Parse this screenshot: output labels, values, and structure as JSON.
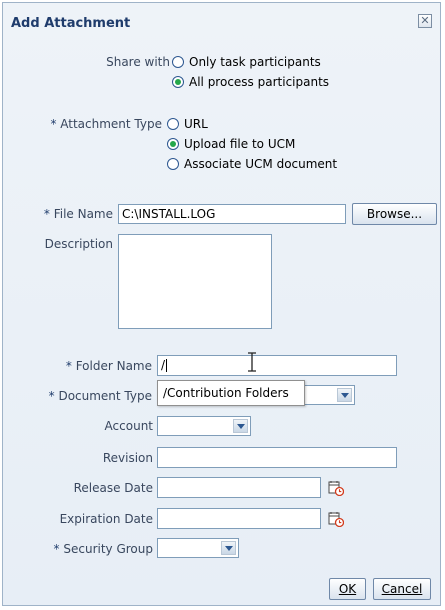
{
  "dialog": {
    "title": "Add Attachment",
    "close_glyph": "✕"
  },
  "share_with": {
    "label": "Share with",
    "options": [
      "Only task participants",
      "All process participants"
    ],
    "selected_index": 1
  },
  "attachment_type": {
    "required": "*",
    "label": "Attachment Type",
    "options": [
      "URL",
      "Upload file to UCM",
      "Associate UCM document"
    ],
    "selected_index": 1
  },
  "file_name": {
    "required": "*",
    "label": "File Name",
    "value": "C:\\INSTALL.LOG",
    "browse_label": "Browse..."
  },
  "description": {
    "label": "Description",
    "value": ""
  },
  "folder_name": {
    "required": "*",
    "label": "Folder Name",
    "value": "/",
    "suggestion": "/Contribution Folders"
  },
  "document_type": {
    "required": "*",
    "label": "Document Type",
    "value": ""
  },
  "account": {
    "label": "Account",
    "value": ""
  },
  "revision": {
    "label": "Revision",
    "value": ""
  },
  "release_date": {
    "label": "Release Date",
    "value": "",
    "icon": "calendar-icon"
  },
  "expiration_date": {
    "label": "Expiration Date",
    "value": "",
    "icon": "calendar-icon"
  },
  "security_group": {
    "required": "*",
    "label": "Security Group",
    "value": ""
  },
  "buttons": {
    "ok": "OK",
    "cancel": "Cancel"
  },
  "colors": {
    "title": "#1f3c6c",
    "label": "#39475e",
    "radio_selected": "#25a84b"
  }
}
